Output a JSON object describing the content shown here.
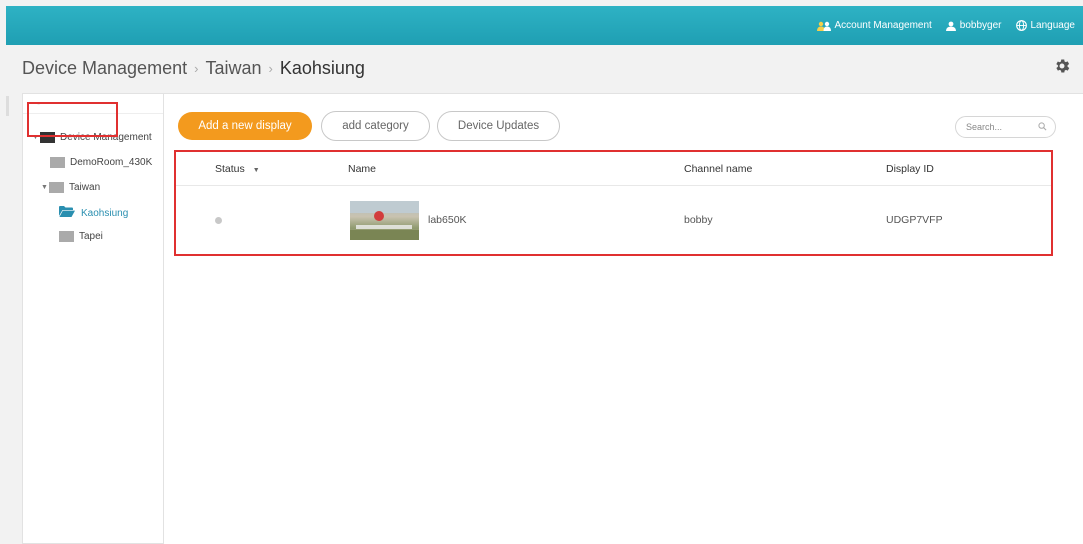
{
  "topbar": {
    "account_management": "Account Management",
    "username": "bobbyger",
    "language": "Language"
  },
  "breadcrumb": {
    "root": "Device Management",
    "level1": "Taiwan",
    "current": "Kaohsiung"
  },
  "sidebar": {
    "tree": [
      {
        "label": "Device Management",
        "expanded": true,
        "icon": "folder-icon"
      },
      {
        "label": "DemoRoom_430K",
        "icon": "folder-icon"
      },
      {
        "label": "Taiwan",
        "expanded": true,
        "icon": "folder-icon"
      },
      {
        "label": "Kaohsiung",
        "selected": true,
        "icon": "folder-open-icon"
      },
      {
        "label": "Tapei",
        "icon": "folder-icon"
      }
    ]
  },
  "toolbar": {
    "add_display": "Add a new display",
    "add_category": "add category",
    "device_updates": "Device Updates",
    "search_placeholder": "Search..."
  },
  "table": {
    "headers": {
      "status": "Status",
      "name": "Name",
      "channel": "Channel name",
      "display_id": "Display ID"
    },
    "rows": [
      {
        "status": "offline",
        "name": "lab650K",
        "channel": "bobby",
        "display_id": "UDGP7VFP"
      }
    ]
  },
  "colors": {
    "topbar": "#1fa5b8",
    "primary_button": "#f39a1e",
    "highlight": "#e03030",
    "selected_tree": "#2a8fb0"
  }
}
